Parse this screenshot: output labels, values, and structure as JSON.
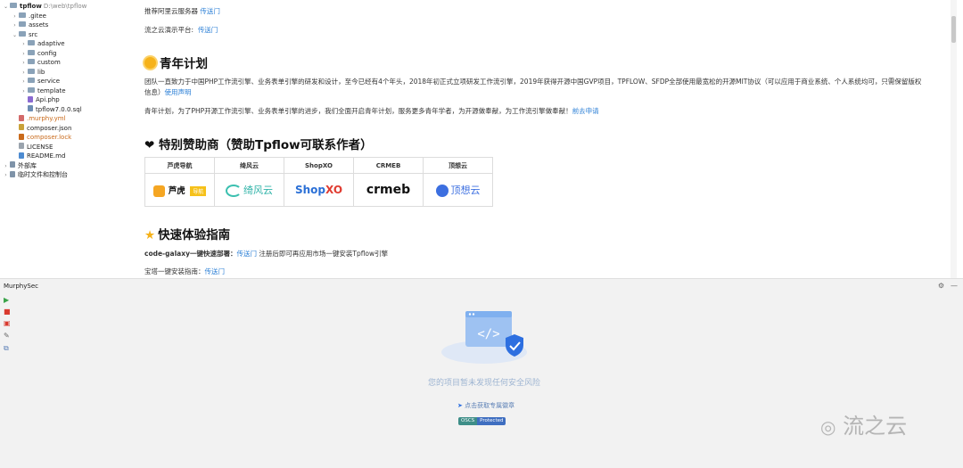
{
  "tree": [
    {
      "name": "tpflow",
      "hint": "D:\\web\\tpflow",
      "type": "folder",
      "depth": 0,
      "open": true,
      "bold": true
    },
    {
      "name": ".gitee",
      "type": "folder",
      "depth": 1
    },
    {
      "name": "assets",
      "type": "folder",
      "depth": 1
    },
    {
      "name": "src",
      "type": "folder",
      "depth": 1,
      "open": true
    },
    {
      "name": "adaptive",
      "type": "folder",
      "depth": 2
    },
    {
      "name": "config",
      "type": "folder",
      "depth": 2
    },
    {
      "name": "custom",
      "type": "folder",
      "depth": 2
    },
    {
      "name": "lib",
      "type": "folder",
      "depth": 2
    },
    {
      "name": "service",
      "type": "folder",
      "depth": 2
    },
    {
      "name": "template",
      "type": "folder",
      "depth": 2
    },
    {
      "name": "Api.php",
      "type": "php",
      "depth": 2
    },
    {
      "name": "tpflow7.0.0.sql",
      "type": "sql",
      "depth": 2
    },
    {
      "name": ".murphy.yml",
      "type": "yml",
      "depth": 1,
      "orange": true
    },
    {
      "name": "composer.json",
      "type": "json",
      "depth": 1
    },
    {
      "name": "composer.lock",
      "type": "lock",
      "depth": 1,
      "orange": true
    },
    {
      "name": "LICENSE",
      "type": "txt",
      "depth": 1
    },
    {
      "name": "README.md",
      "type": "md",
      "depth": 1
    },
    {
      "name": "外部库",
      "type": "lib",
      "depth": 0
    },
    {
      "name": "临时文件和控制台",
      "type": "scratch",
      "depth": 0
    }
  ],
  "readme": {
    "l1_text": "推荐阿里云服务器",
    "l1_link": "传送门",
    "l2_text": "流之云演示平台:",
    "l2_link": "传送门",
    "youth_title": "青年计划",
    "youth_p1a": "团队一直致力于中国PHP工作流引擎、业务表单引擎的研发和设计，至今已经有4个年头，2018年初正式立项研发工作流引擎，2019年获得开源中国GVP项目，TPFLOW、SFDP全部使用最宽松的开源MIT协议（可以应用于商业系统、个人系统均可，只需保留版权",
    "youth_p1b": "信息）",
    "youth_p1_link": "使用声明",
    "youth_p2": "青年计划，为了PHP开源工作流引擎、业务表单引擎的进步，我们全面开启青年计划，服务更多青年学者，为开源做奉献，为工作流引擎做奉献！",
    "youth_p2_link": "前去申请",
    "sponsor_title": "特别赞助商（赞助Tpflow可联系作者）",
    "sponsors": [
      {
        "name": "芦虎导航",
        "logo": "芦虎",
        "tag": "导航"
      },
      {
        "name": "绮风云",
        "logo": "绮风云"
      },
      {
        "name": "ShopXO",
        "logo_a": "Shop",
        "logo_b": "XO"
      },
      {
        "name": "CRMEB",
        "logo": "crmeb"
      },
      {
        "name": "顶想云",
        "logo": "顶想云"
      }
    ],
    "quick_title": "快速体验指南",
    "quick_p1": "code-galaxy一键快速部署：",
    "quick_p1_link": "传送门",
    "quick_p1_tail": "注册后即可再应用市场一键安装Tpflow引擎",
    "quick_p2": "宝塔一键安装指南：",
    "quick_p2_link": "传送门"
  },
  "panel": {
    "title": "MurphySec",
    "empty": "您的项目暂未发现任何安全风险",
    "feedback": "点击获取专属徽章",
    "badge_left": "OSCS",
    "badge_right": "Protected"
  },
  "watermark": "流之云",
  "colors": {
    "link": "#2b7fd6",
    "accent_blue": "#3e7ee0",
    "sun": "#f6b21a"
  }
}
